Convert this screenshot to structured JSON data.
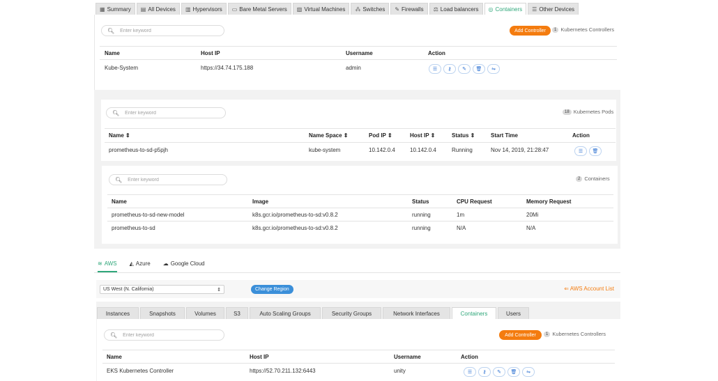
{
  "top_tabs": [
    {
      "icon": "summary-icon",
      "label": "Summary"
    },
    {
      "icon": "devices-icon",
      "label": "All Devices"
    },
    {
      "icon": "hypervisor-icon",
      "label": "Hypervisors"
    },
    {
      "icon": "server-icon",
      "label": "Bare Metal Servers"
    },
    {
      "icon": "vm-icon",
      "label": "Virtual Machines"
    },
    {
      "icon": "switch-icon",
      "label": "Switches"
    },
    {
      "icon": "firewall-icon",
      "label": "Firewalls"
    },
    {
      "icon": "load-balancer-icon",
      "label": "Load balancers"
    },
    {
      "icon": "containers-icon",
      "label": "Containers"
    },
    {
      "icon": "other-devices-icon",
      "label": "Other Devices"
    }
  ],
  "controllers": {
    "search_placeholder": "Enter keyword",
    "add_label": "Add Controller",
    "count": "1",
    "count_label": "Kubernetes Controllers",
    "columns": [
      "Name",
      "Host IP",
      "Username",
      "Action"
    ],
    "rows": [
      {
        "name": "Kube-System",
        "host_ip": "https://34.74.175.188",
        "username": "admin"
      }
    ]
  },
  "pods": {
    "search_placeholder": "Enter keyword",
    "count": "18",
    "count_label": "Kubernetes Pods",
    "columns": [
      "Name ⇕",
      "Name Space ⇕",
      "Pod IP ⇕",
      "Host IP ⇕",
      "Status ⇕",
      "Start Time",
      "Action"
    ],
    "rows": [
      {
        "name": "prometheus-to-sd-p5pjh",
        "namespace": "kube-system",
        "pod_ip": "10.142.0.4",
        "host_ip": "10.142.0.4",
        "status": "Running",
        "start_time": "Nov 14, 2019, 21:28:47"
      }
    ]
  },
  "containers": {
    "search_placeholder": "Enter keyword",
    "count": "2",
    "count_label": "Containers",
    "columns": [
      "Name",
      "Image",
      "Status",
      "CPU Request",
      "Memory Request"
    ],
    "rows": [
      {
        "name": "prometheus-to-sd-new-model",
        "image": "k8s.gcr.io/prometheus-to-sd:v0.8.2",
        "status": "running",
        "cpu": "1m",
        "memory": "20Mi"
      },
      {
        "name": "prometheus-to-sd",
        "image": "k8s.gcr.io/prometheus-to-sd:v0.8.2",
        "status": "running",
        "cpu": "N/A",
        "memory": "N/A"
      }
    ]
  },
  "cloud_tabs": [
    {
      "icon": "aws-icon",
      "label": "AWS"
    },
    {
      "icon": "azure-icon",
      "label": "Azure"
    },
    {
      "icon": "google-cloud-icon",
      "label": "Google Cloud"
    }
  ],
  "aws": {
    "region": "US West (N. California)",
    "change_region_label": "Change Region",
    "account_list_label": "AWS Account List",
    "tabs": [
      "Instances",
      "Snapshots",
      "Volumes",
      "S3",
      "Auto Scaling Groups",
      "Security Groups",
      "Network Interfaces",
      "Containers",
      "Users"
    ],
    "search_placeholder": "Enter keyword",
    "add_label": "Add Controller",
    "count": "1",
    "count_label": "Kubernetes Controllers",
    "columns": [
      "Name",
      "Host IP",
      "Username",
      "Action"
    ],
    "rows": [
      {
        "name": "EKS Kubernetes Controller",
        "host_ip": "https://52.70.211.132:6443",
        "username": "unity"
      }
    ]
  },
  "colors": {
    "accent_green": "#2fa77a",
    "orange": "#f47c0f",
    "blue": "#3b8fd9"
  }
}
